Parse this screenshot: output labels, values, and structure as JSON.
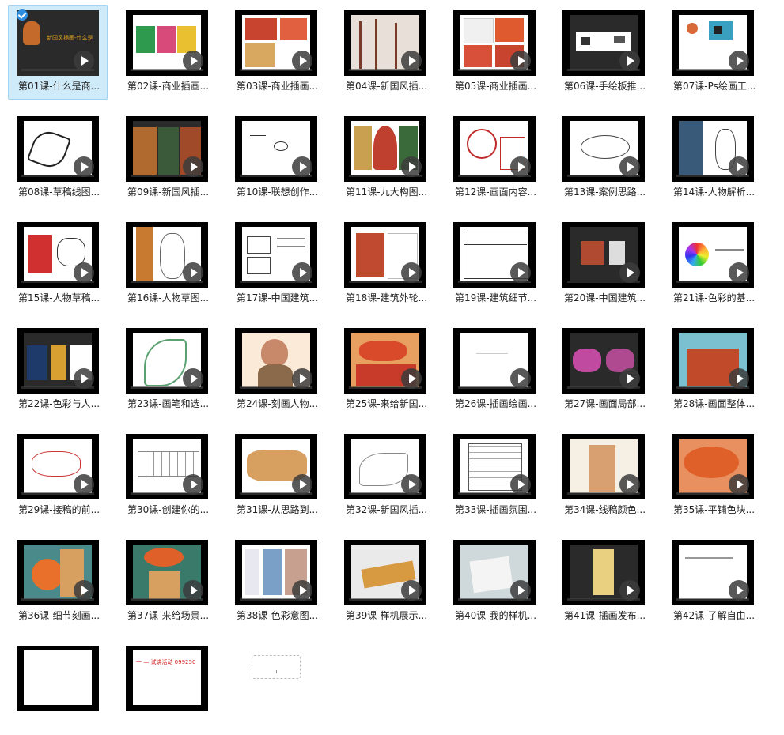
{
  "lessons": [
    {
      "label": "第01课-什么是商...",
      "selected": true
    },
    {
      "label": "第02课-商业插画..."
    },
    {
      "label": "第03课-商业插画..."
    },
    {
      "label": "第04课-新国风插..."
    },
    {
      "label": "第05课-商业插画..."
    },
    {
      "label": "第06课-手绘板推..."
    },
    {
      "label": "第07课-Ps绘画工..."
    },
    {
      "label": "第08课-草稿线图..."
    },
    {
      "label": "第09课-新国风插..."
    },
    {
      "label": "第10课-联想创作..."
    },
    {
      "label": "第11课-九大构图..."
    },
    {
      "label": "第12课-画面内容..."
    },
    {
      "label": "第13课-案例思路..."
    },
    {
      "label": "第14课-人物解析..."
    },
    {
      "label": "第15课-人物草稿..."
    },
    {
      "label": "第16课-人物草图..."
    },
    {
      "label": "第17课-中国建筑..."
    },
    {
      "label": "第18课-建筑外轮..."
    },
    {
      "label": "第19课-建筑细节..."
    },
    {
      "label": "第20课-中国建筑..."
    },
    {
      "label": "第21课-色彩的基..."
    },
    {
      "label": "第22课-色彩与人..."
    },
    {
      "label": "第23课-画笔和选..."
    },
    {
      "label": "第24课-刻画人物..."
    },
    {
      "label": "第25课-来给新国..."
    },
    {
      "label": "第26课-插画绘画..."
    },
    {
      "label": "第27课-画面局部..."
    },
    {
      "label": "第28课-画面整体..."
    },
    {
      "label": "第29课-接稿的前..."
    },
    {
      "label": "第30课-创建你的..."
    },
    {
      "label": "第31课-从思路到..."
    },
    {
      "label": "第32课-新国风插..."
    },
    {
      "label": "第33课-插画氛围..."
    },
    {
      "label": "第34课-线稿颜色..."
    },
    {
      "label": "第35课-平铺色块..."
    },
    {
      "label": "第36课-细节刻画..."
    },
    {
      "label": "第37课-来给场景..."
    },
    {
      "label": "第38课-色彩意图..."
    },
    {
      "label": "第39课-样机展示..."
    },
    {
      "label": "第40课-我的样机..."
    },
    {
      "label": "第41课-插画发布..."
    },
    {
      "label": "第42课-了解自由..."
    },
    {
      "label": ""
    },
    {
      "label": ""
    }
  ],
  "thumb_text": {
    "t1": "新国风插画-什么是",
    "t44": "一 — 试讲活动 099250"
  },
  "colors": {
    "selection_bg": "#cfeaf8",
    "selection_border": "#9fd3f0",
    "check": "#2e8fe0"
  }
}
